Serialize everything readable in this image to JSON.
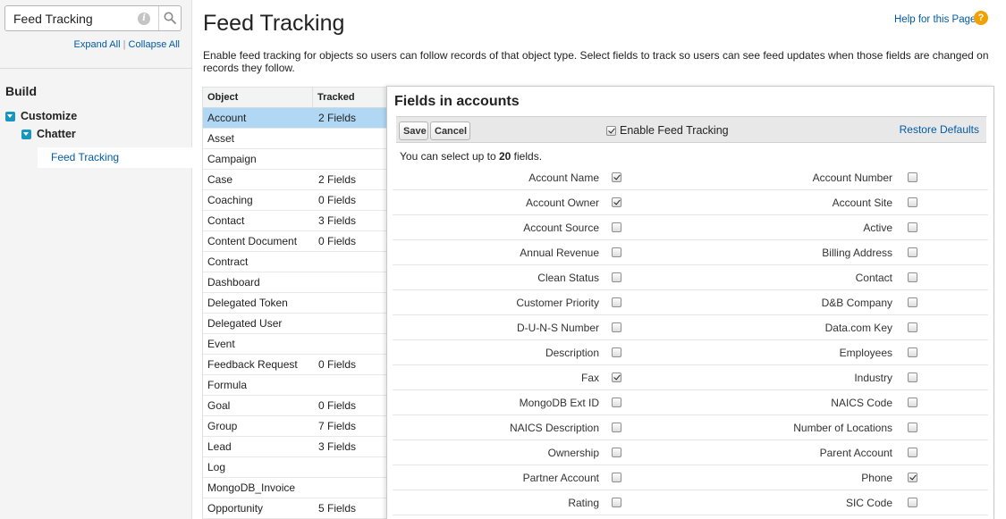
{
  "sidebar": {
    "search_value": "Feed Tracking",
    "expand_all": "Expand All",
    "separator": "|",
    "collapse_all": "Collapse All",
    "build_heading": "Build",
    "tree": {
      "customize": "Customize",
      "chatter": "Chatter",
      "feed_tracking": "Feed Tracking"
    }
  },
  "header": {
    "title": "Feed Tracking",
    "help_link": "Help for this Page",
    "description": "Enable feed tracking for objects so users can follow records of that object type. Select fields to track so users can see feed updates when those fields are changed on records they follow."
  },
  "objects": {
    "col_object": "Object",
    "col_tracked": "Tracked",
    "rows": [
      {
        "name": "Account",
        "tracked": "2 Fields",
        "selected": true
      },
      {
        "name": "Asset",
        "tracked": ""
      },
      {
        "name": "Campaign",
        "tracked": ""
      },
      {
        "name": "Case",
        "tracked": "2 Fields"
      },
      {
        "name": "Coaching",
        "tracked": "0 Fields"
      },
      {
        "name": "Contact",
        "tracked": "3 Fields"
      },
      {
        "name": "Content Document",
        "tracked": "0 Fields"
      },
      {
        "name": "Contract",
        "tracked": ""
      },
      {
        "name": "Dashboard",
        "tracked": ""
      },
      {
        "name": "Delegated Token",
        "tracked": ""
      },
      {
        "name": "Delegated User",
        "tracked": ""
      },
      {
        "name": "Event",
        "tracked": ""
      },
      {
        "name": "Feedback Request",
        "tracked": "0 Fields"
      },
      {
        "name": "Formula",
        "tracked": ""
      },
      {
        "name": "Goal",
        "tracked": "0 Fields"
      },
      {
        "name": "Group",
        "tracked": "7 Fields"
      },
      {
        "name": "Lead",
        "tracked": "3 Fields"
      },
      {
        "name": "Log",
        "tracked": ""
      },
      {
        "name": "MongoDB_Invoice",
        "tracked": ""
      },
      {
        "name": "Opportunity",
        "tracked": "5 Fields"
      }
    ]
  },
  "fields_panel": {
    "title": "Fields in accounts",
    "save_label": "Save",
    "cancel_label": "Cancel",
    "enable_label": "Enable Feed Tracking",
    "enable_checked": true,
    "restore_label": "Restore Defaults",
    "limit_prefix": "You can select up to ",
    "limit_count": "20",
    "limit_suffix": " fields.",
    "rows": [
      {
        "left": "Account Name",
        "left_checked": true,
        "right": "Account Number",
        "right_checked": false
      },
      {
        "left": "Account Owner",
        "left_checked": true,
        "right": "Account Site",
        "right_checked": false
      },
      {
        "left": "Account Source",
        "left_checked": false,
        "right": "Active",
        "right_checked": false
      },
      {
        "left": "Annual Revenue",
        "left_checked": false,
        "right": "Billing Address",
        "right_checked": false
      },
      {
        "left": "Clean Status",
        "left_checked": false,
        "right": "Contact",
        "right_checked": false
      },
      {
        "left": "Customer Priority",
        "left_checked": false,
        "right": "D&B Company",
        "right_checked": false
      },
      {
        "left": "D-U-N-S Number",
        "left_checked": false,
        "right": "Data.com Key",
        "right_checked": false
      },
      {
        "left": "Description",
        "left_checked": false,
        "right": "Employees",
        "right_checked": false
      },
      {
        "left": "Fax",
        "left_checked": true,
        "right": "Industry",
        "right_checked": false
      },
      {
        "left": "MongoDB Ext ID",
        "left_checked": false,
        "right": "NAICS Code",
        "right_checked": false
      },
      {
        "left": "NAICS Description",
        "left_checked": false,
        "right": "Number of Locations",
        "right_checked": false
      },
      {
        "left": "Ownership",
        "left_checked": false,
        "right": "Parent Account",
        "right_checked": false
      },
      {
        "left": "Partner Account",
        "left_checked": false,
        "right": "Phone",
        "right_checked": true
      },
      {
        "left": "Rating",
        "left_checked": false,
        "right": "SIC Code",
        "right_checked": false
      }
    ]
  },
  "colors": {
    "link": "#015ba7",
    "selected_row": "#b0d8f5",
    "tree_toggle": "#1797c0",
    "help_icon": "#f2a200"
  }
}
